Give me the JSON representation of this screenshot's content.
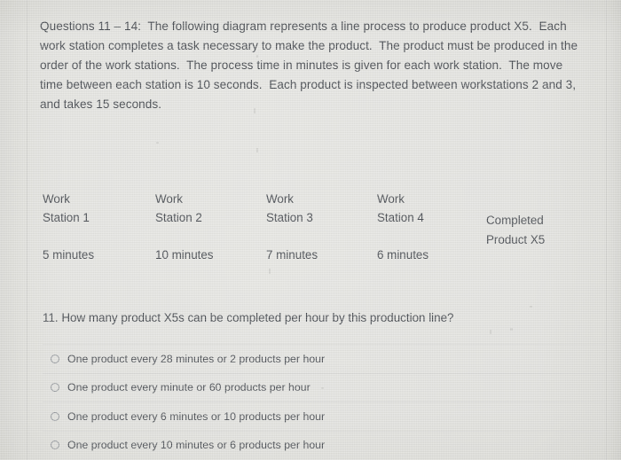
{
  "document": {
    "intro_lines": [
      "Questions 11 – 14:  The following diagram represents a line process to produce product X5.  Each",
      "work station completes a task necessary to make the product.  The product must be produced in the",
      "order of the work stations.  The process time in minutes is given for each work station.  The move",
      "time between each station is 10 seconds.  Each product is inspected between workstations 2 and 3,",
      "and takes 15 seconds."
    ],
    "diagram": {
      "stations": [
        {
          "name_line1": "Work",
          "name_line2": "Station 1",
          "time": "5 minutes"
        },
        {
          "name_line1": "Work",
          "name_line2": "Station 2",
          "time": "10 minutes"
        },
        {
          "name_line1": "Work",
          "name_line2": "Station 3",
          "time": "7 minutes"
        },
        {
          "name_line1": "Work",
          "name_line2": "Station 4",
          "time": "6 minutes"
        }
      ],
      "output_line1": "Completed",
      "output_line2": "Product X5"
    },
    "question": {
      "text": "11. How many product X5s can be completed per hour by this production line?",
      "options": [
        {
          "label": "One product every 28 minutes or 2 products per hour"
        },
        {
          "label": "One product every minute or 60 products per hour"
        },
        {
          "label": "One product every 6 minutes or 10 products per hour"
        },
        {
          "label": "One product every 10 minutes or 6 products per hour"
        }
      ]
    }
  }
}
